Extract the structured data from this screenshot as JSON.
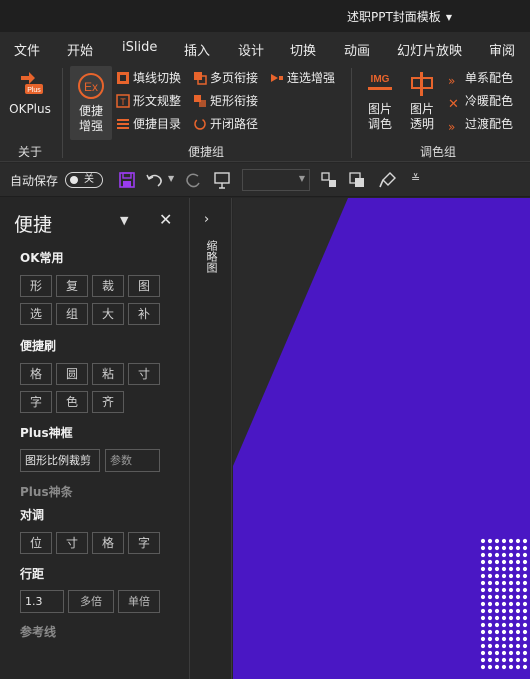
{
  "window": {
    "doc_title": "述职PPT封面模板"
  },
  "menu": {
    "tabs": [
      "文件",
      "开始",
      "iSlide",
      "插入",
      "设计",
      "切换",
      "动画",
      "幻灯片放映",
      "审阅"
    ]
  },
  "ribbon": {
    "about": {
      "okplus_label": "OKPlus",
      "group_label": "关于"
    },
    "quick": {
      "big_button": "便捷增强",
      "col1": [
        "填线切换",
        "形文规整",
        "便捷目录"
      ],
      "col2": [
        "多页衔接",
        "矩形衔接",
        "开闭路径"
      ],
      "col3": [
        "连选增强"
      ],
      "group_label": "便捷组"
    },
    "color": {
      "picture_color": "图片调色",
      "picture_transparent": "图片透明",
      "side": [
        "单系配色",
        "冷暖配色",
        "过渡配色"
      ],
      "group_label": "调色组"
    }
  },
  "qat": {
    "autosave_label": "自动保存",
    "autosave_state": "关"
  },
  "panel": {
    "title": "便捷",
    "sections": {
      "ok_common": "OK常用",
      "quick_brush": "便捷刷",
      "plus_frame": "Plus神框",
      "plus_bar": "Plus神条",
      "align": "对调",
      "line_spacing": "行距",
      "guides": "参考线"
    },
    "ok_buttons": [
      "形",
      "复",
      "裁",
      "图",
      "选",
      "组",
      "大",
      "补"
    ],
    "brush_buttons": [
      "格",
      "圆",
      "粘",
      "寸",
      "字",
      "色",
      "齐"
    ],
    "plus_frame": {
      "crop_label": "图形比例裁剪",
      "param_placeholder": "参数"
    },
    "align_buttons": [
      "位",
      "寸",
      "格",
      "字"
    ],
    "line_spacing": {
      "value": "1.3",
      "multi": "多倍",
      "single": "单倍"
    }
  },
  "side_strip": {
    "label": "缩略图"
  },
  "colors": {
    "accent_orange": "#e8642c",
    "slide_purple": "#4a17c4",
    "save_purple": "#9b3cf0"
  }
}
